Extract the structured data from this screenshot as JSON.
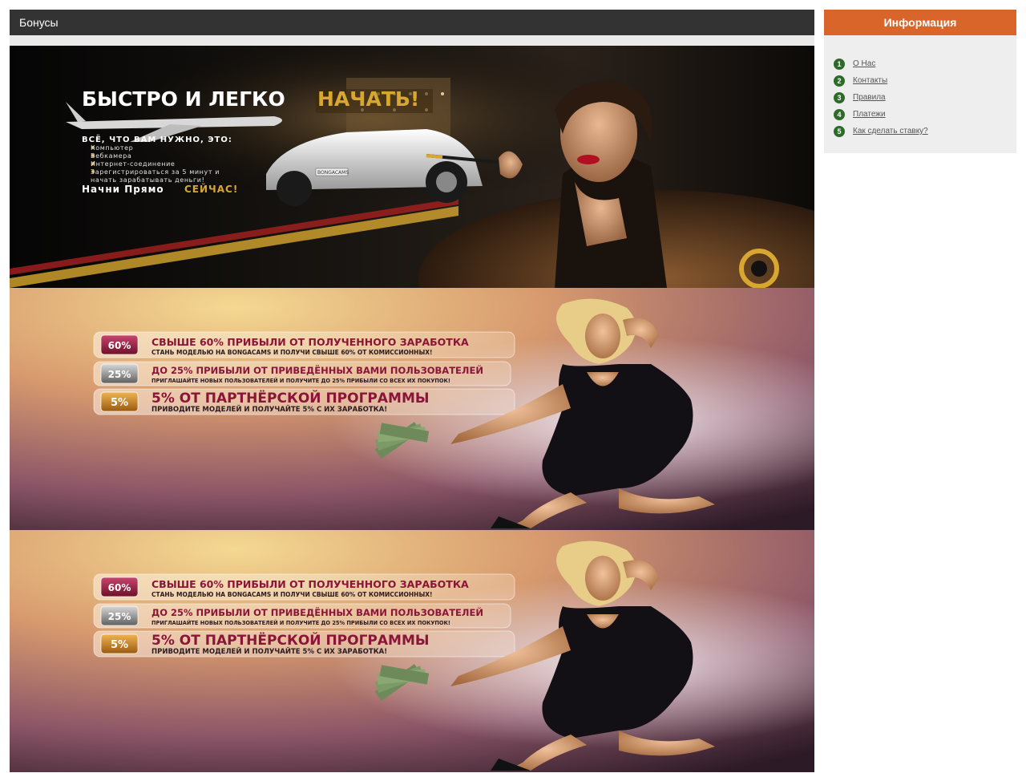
{
  "main": {
    "title": "Бонусы"
  },
  "sidebar": {
    "title": "Информация",
    "items": [
      {
        "num": "1",
        "label": "О Нас"
      },
      {
        "num": "2",
        "label": "Контакты"
      },
      {
        "num": "3",
        "label": "Правила"
      },
      {
        "num": "4",
        "label": "Платежи"
      },
      {
        "num": "5",
        "label": "Как сделать ставку?"
      }
    ]
  },
  "banner1": {
    "headline_a": "БЫСТРО И ЛЕГКО",
    "headline_b": "НАЧАТЬ!",
    "needs_title": "ВСЁ, ЧТО ВАМ НУЖНО, ЭТО:",
    "needs": [
      "Компьютер",
      "Вебкамера",
      "Интернет-соединение",
      "Зарегистрироваться за 5 минут и",
      "начать зарабатывать деньги!"
    ],
    "cta_a": "Начни Прямо",
    "cta_b": "СЕЙЧАС!",
    "car_plate": "BONGACAMS"
  },
  "banner2": {
    "offers": [
      {
        "badge": "60%",
        "title": "СВЫШЕ 60% ПРИБЫЛИ ОТ ПОЛУЧЕННОГО ЗАРАБОТКА",
        "sub": "СТАНЬ МОДЕЛЬЮ НА BONGACAMS И ПОЛУЧИ СВЫШЕ 60% ОТ КОМИССИОННЫХ!"
      },
      {
        "badge": "25%",
        "title": "ДО 25% ПРИБЫЛИ ОТ ПРИВЕДЁННЫХ ВАМИ ПОЛЬЗОВАТЕЛЕЙ",
        "sub": "ПРИГЛАШАЙТЕ НОВЫХ ПОЛЬЗОВАТЕЛЕЙ И ПОЛУЧИТЕ ДО 25% ПРИБЫЛИ СО ВСЕХ ИХ ПОКУПОК!"
      },
      {
        "badge": "5%",
        "title": "5% ОТ ПАРТНЁРСКОЙ ПРОГРАММЫ",
        "sub": "ПРИВОДИТЕ МОДЕЛЕЙ И ПОЛУЧАЙТЕ 5% С ИХ ЗАРАБОТКА!"
      }
    ]
  },
  "colors": {
    "header_bg": "#333333",
    "sidebar_header_bg": "#d9652a",
    "sidebar_bg": "#eeeeee",
    "list_number_bg": "#2e6b2a",
    "offer_title": "#8a1538",
    "headline_gold": "#d8a730"
  }
}
